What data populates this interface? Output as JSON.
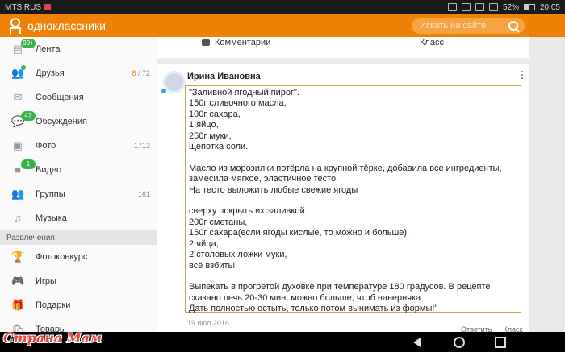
{
  "statusbar": {
    "carrier": "MTS RUS",
    "battery": "52%",
    "time": "20:05"
  },
  "app": {
    "title": "одноклассники"
  },
  "search": {
    "placeholder": "Искать на сайте"
  },
  "sidebar": {
    "items": [
      {
        "label": "Лента",
        "badge": "99+",
        "icon": "feed-icon"
      },
      {
        "label": "Друзья",
        "count_highlight": "8",
        "count_rest": " / 72",
        "icon": "friends-icon"
      },
      {
        "label": "Сообщения",
        "icon": "mail-icon"
      },
      {
        "label": "Обсуждения",
        "badge": "47",
        "icon": "discussions-icon"
      },
      {
        "label": "Фото",
        "count": "1713",
        "icon": "photo-icon"
      },
      {
        "label": "Видео",
        "badge": "1",
        "icon": "video-icon"
      },
      {
        "label": "Группы",
        "count": "161",
        "icon": "groups-icon"
      },
      {
        "label": "Музыка",
        "icon": "music-icon"
      }
    ],
    "section": "Развлечения",
    "items2": [
      {
        "label": "Фотоконкурс",
        "icon": "trophy-icon"
      },
      {
        "label": "Игры",
        "icon": "games-icon"
      },
      {
        "label": "Подарки",
        "icon": "gift-icon"
      },
      {
        "label": "Товары",
        "icon": "goods-icon"
      }
    ]
  },
  "prev_post": {
    "comments": "Комментарии",
    "like": "Класс"
  },
  "post": {
    "author": "Ирина Ивановна",
    "text": "\"Заливной ягодный пирог\".\n150г сливочного масла,\n100г сахара,\n1 яйцо,\n250г муки,\nщепотка соли.\n\nМасло из морозилки потёрла на крупной тёрке, добавила все ингредиенты, замесила мягкое, эластичное тесто.\nНа тесто выложить любые свежие ягоды\n\nсверху покрыть их заливкой:\n200г сметаны,\n150г сахара(если ягоды кислые, то можно и больше),\n2 яйца,\n2 столовых ложки муки,\nвсё взбить!\n\nВыпекать в прогретой духовке при температуре 180 градусов. В рецепте сказано печь 20-30 мин, можно больше, чтоб наверняка\nДать полностью остыть, только потом вынимать из формы!\"",
    "date": "19 июл 2016",
    "reply": "Ответить",
    "like": "Класс"
  },
  "watermark": "Страна Мам"
}
